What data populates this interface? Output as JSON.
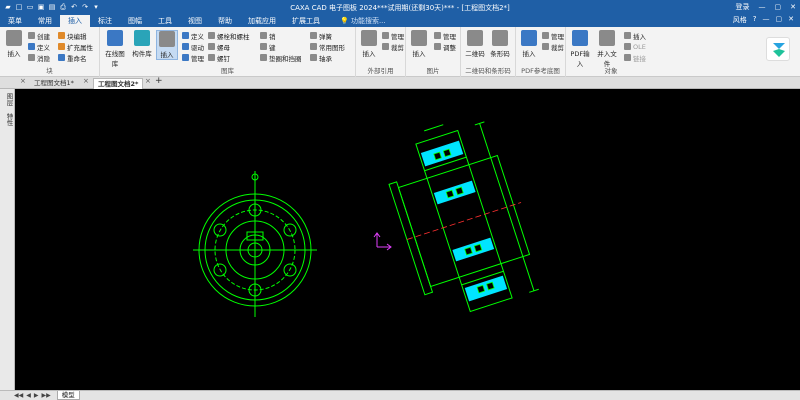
{
  "app": {
    "title": "CAXA CAD 电子图板 2024***试用期(还剩30天)*** - [工程图文档2*]",
    "login": "登录",
    "style_label": "风格"
  },
  "tabs": [
    "菜单",
    "常用",
    "插入",
    "标注",
    "图幅",
    "工具",
    "视图",
    "帮助",
    "加载应用",
    "扩展工具"
  ],
  "active_tab": "插入",
  "search_placeholder": "功能搜索...",
  "ribbon": {
    "block": {
      "label": "块",
      "insert": "插入",
      "create": "创建",
      "define": "定义",
      "dissolve": "消隐",
      "block_edit": "块编辑",
      "extend_attr": "扩充属性",
      "rename": "重命名"
    },
    "library": {
      "label": "图库",
      "online": "在线图库",
      "component": "构件库",
      "insert": "插入",
      "define": "定义",
      "drive": "驱动",
      "manage": "管理",
      "bolt_screw": "螺栓和螺柱",
      "nut": "螺母",
      "rivet": "螺钉",
      "pin": "销",
      "key": "键",
      "washer": "垫圈和挡圈",
      "spring": "弹簧",
      "common_shape": "常用图形",
      "bearing": "轴承"
    },
    "external": {
      "label": "外部引用",
      "insert": "插入",
      "manage": "管理",
      "clip": "裁剪"
    },
    "image": {
      "label": "图片",
      "insert": "插入",
      "manage": "管理",
      "adjust": "调整"
    },
    "barcode": {
      "label": "二维码和条形码",
      "qrcode": "二维码",
      "barcode": "条形码"
    },
    "pdf": {
      "label": "PDF参考底图",
      "insert": "插入",
      "manage": "管理",
      "clip": "裁剪"
    },
    "object": {
      "label": "对象",
      "pdf_in": "PDF输入",
      "open_file": "并入文件",
      "insert": "插入",
      "ole": "OLE",
      "link": "链接"
    }
  },
  "doc_tabs": [
    "工程图文档1*",
    "工程图文档2*"
  ],
  "active_doc": "工程图文档2*",
  "left_tools": [
    "图层",
    "特性"
  ],
  "model_tab": "模型",
  "colors": {
    "title_blue": "#1f5fa6",
    "drawing_green": "#00ff00",
    "fill_cyan": "#00e5ff",
    "axis_magenta": "#e040fb",
    "centerline_red": "#ff3030"
  }
}
